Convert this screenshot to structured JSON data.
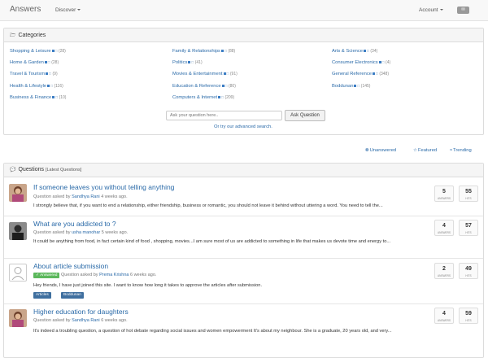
{
  "navbar": {
    "brand": "Answers",
    "discover": "Discover",
    "account": "Account"
  },
  "categories": {
    "heading": "Categories",
    "columns": [
      [
        {
          "name": "Shopping & Leisure",
          "count": "(28)"
        },
        {
          "name": "Home & Garden",
          "count": "(28)"
        },
        {
          "name": "Travel & Tourism",
          "count": "(9)"
        },
        {
          "name": "Health & Lifestyle",
          "count": "(116)"
        },
        {
          "name": "Business & Finance",
          "count": "(10)"
        }
      ],
      [
        {
          "name": "Family & Relationships",
          "count": "(88)"
        },
        {
          "name": "Politics",
          "count": "(41)"
        },
        {
          "name": "Movies & Entertainment",
          "count": "(91)"
        },
        {
          "name": "Education & Reference",
          "count": "(80)"
        },
        {
          "name": "Computers & Internet",
          "count": "(209)"
        }
      ],
      [
        {
          "name": "Arts & Science",
          "count": "(34)"
        },
        {
          "name": "Consumer Electronics",
          "count": "(4)"
        },
        {
          "name": "General Reference",
          "count": "(348)"
        },
        {
          "name": "Boddunan",
          "count": "(145)"
        }
      ]
    ],
    "ask_placeholder": "Ask your question here..",
    "ask_button": "Ask Question",
    "advanced_link": "Or try our advanced search."
  },
  "filters": {
    "unanswered": "Unanswered",
    "featured": "Featured",
    "trending": "Trending"
  },
  "questions": {
    "heading": "Questions",
    "subheading": "[Latest Questions]",
    "asked_by_label": "Question asked by",
    "answers_label": "ANSWERS",
    "hits_label": "HITS",
    "items": [
      {
        "title": "If someone leaves you without telling anything",
        "author": "Sandhya Rani",
        "time": "4 weeks ago.",
        "excerpt": "I strongly believe that, if you want to end a relationship, either friendship, business or romantic, you should not leave it behind without uttering a word. You need to tell the...",
        "answers": "5",
        "hits": "55"
      },
      {
        "title": "What are you addicted to ?",
        "author": "usha manohar",
        "time": "5 weeks ago.",
        "excerpt": "It could be anything from food, in fact certain kind of food , shopping, movies...I am sure most of us are addicted to something in life that makes us devote time and energy to...",
        "answers": "4",
        "hits": "57"
      },
      {
        "title": "About article submission",
        "badge": "Answered",
        "author": "Prema Krishna",
        "time": "6 weeks ago.",
        "excerpt": "Hey friends, I have just joined this site. I want to know how long it takes to approve the articles after submission.",
        "tags": [
          "Articles",
          "Boddunan"
        ],
        "answers": "2",
        "hits": "49"
      },
      {
        "title": "Higher education for daughters",
        "author": "Sandhya Rani",
        "time": "6 weeks ago.",
        "excerpt": "It's indeed a troubling question, a question of hot debate regarding social issues and women empowerment It's about my neighbour. She is a graduate, 20 years old, and very...",
        "answers": "4",
        "hits": "59"
      }
    ]
  }
}
